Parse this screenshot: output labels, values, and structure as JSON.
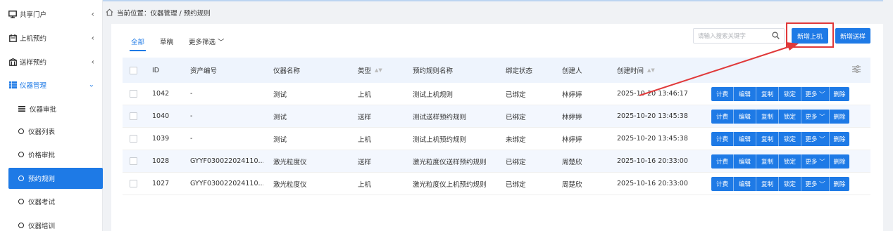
{
  "sidebar": {
    "items": [
      {
        "label": "共享门户",
        "icon": "monitor-icon"
      },
      {
        "label": "上机预约",
        "icon": "calendar-icon"
      },
      {
        "label": "送样预约",
        "icon": "building-icon"
      },
      {
        "label": "仪器管理",
        "icon": "grid-icon"
      }
    ],
    "sub_items": [
      {
        "label": "仪器审批",
        "icon": "list-icon"
      },
      {
        "label": "仪器列表",
        "icon": "circle-icon"
      },
      {
        "label": "价格审批",
        "icon": "circle-icon"
      },
      {
        "label": "预约规则",
        "icon": "circle-icon"
      },
      {
        "label": "仪器考试",
        "icon": "circle-icon"
      },
      {
        "label": "仪器培训",
        "icon": "circle-icon"
      }
    ]
  },
  "breadcrumb": {
    "text": "当前位置：仪器管理 / 预约规则"
  },
  "tabs": [
    {
      "label": "全部"
    },
    {
      "label": "草稿"
    },
    {
      "label": "更多筛选 ﹀"
    }
  ],
  "search": {
    "placeholder": "请输入搜索关键字"
  },
  "buttons": {
    "add_machine": "新增上机",
    "add_sample": "新增送样"
  },
  "table": {
    "headers": [
      "ID",
      "资产编号",
      "仪器名称",
      "类型",
      "预约规则名称",
      "绑定状态",
      "创建人",
      "创建时间"
    ],
    "rows": [
      {
        "id": "1042",
        "asset": "-",
        "name": "测试",
        "type": "上机",
        "rule": "测试上机规则",
        "status": "已绑定",
        "creator": "林婷婷",
        "time": "2025-10-20 13:46:17"
      },
      {
        "id": "1040",
        "asset": "-",
        "name": "测试",
        "type": "送样",
        "rule": "测试送样预约规则",
        "status": "已绑定",
        "creator": "林婷婷",
        "time": "2025-10-20 13:45:38"
      },
      {
        "id": "1039",
        "asset": "-",
        "name": "测试",
        "type": "上机",
        "rule": "测试上机预约规则",
        "status": "未绑定",
        "creator": "林婷婷",
        "time": "2025-10-20 13:45:38"
      },
      {
        "id": "1028",
        "asset": "GYYF030022024110...",
        "name": "激光粒度仪",
        "type": "送样",
        "rule": "激光粒度仪送样预约规则",
        "status": "已绑定",
        "creator": "周楚欣",
        "time": "2025-10-16 20:33:00"
      },
      {
        "id": "1027",
        "asset": "GYYF030022024110...",
        "name": "激光粒度仪",
        "type": "上机",
        "rule": "激光粒度仪上机预约规则",
        "status": "已绑定",
        "creator": "周楚欣",
        "time": "2025-10-16 20:33:00"
      }
    ],
    "ops": [
      "计费",
      "编辑",
      "复制",
      "锁定",
      "更多 ﹀",
      "删除"
    ]
  },
  "colors": {
    "primary": "#1e7ae6",
    "annotation": "#e0393a"
  }
}
